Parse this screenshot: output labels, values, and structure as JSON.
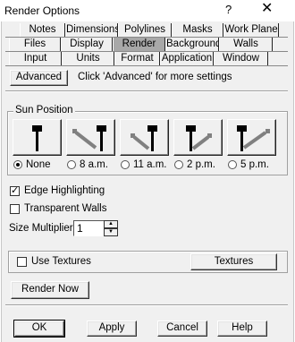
{
  "window": {
    "title": "Render Options",
    "help_label": "?",
    "close_label": "✕"
  },
  "tabs": {
    "row1": [
      "Notes",
      "Dimensions",
      "Polylines",
      "Masks",
      "Work Plane"
    ],
    "row2": [
      "Files",
      "Display",
      "Render",
      "Background",
      "Walls"
    ],
    "row3": [
      "Input",
      "Units",
      "Format",
      "Application",
      "Window"
    ],
    "active": "Render"
  },
  "advanced": {
    "button_label": "Advanced",
    "hint": "Click 'Advanced' for more settings"
  },
  "sun_position": {
    "legend": "Sun Position",
    "options": [
      {
        "label": "None",
        "icon": "sun-none-icon"
      },
      {
        "label": "8 a.m.",
        "icon": "sun-8am-icon"
      },
      {
        "label": "11 a.m.",
        "icon": "sun-11am-icon"
      },
      {
        "label": "2 p.m.",
        "icon": "sun-2pm-icon"
      },
      {
        "label": "5 p.m.",
        "icon": "sun-5pm-icon"
      }
    ],
    "selected": "None"
  },
  "edge_highlighting": {
    "label": "Edge Highlighting",
    "checked": true
  },
  "transparent_walls": {
    "label": "Transparent Walls",
    "checked": false
  },
  "size_multiplier": {
    "label": "Size Multiplier",
    "value": "1"
  },
  "textures": {
    "use_label": "Use Textures",
    "use_checked": false,
    "button_label": "Textures"
  },
  "render_now": {
    "label": "Render Now"
  },
  "footer": {
    "ok": "OK",
    "apply": "Apply",
    "cancel": "Cancel",
    "help": "Help"
  },
  "check_glyph": "✓"
}
